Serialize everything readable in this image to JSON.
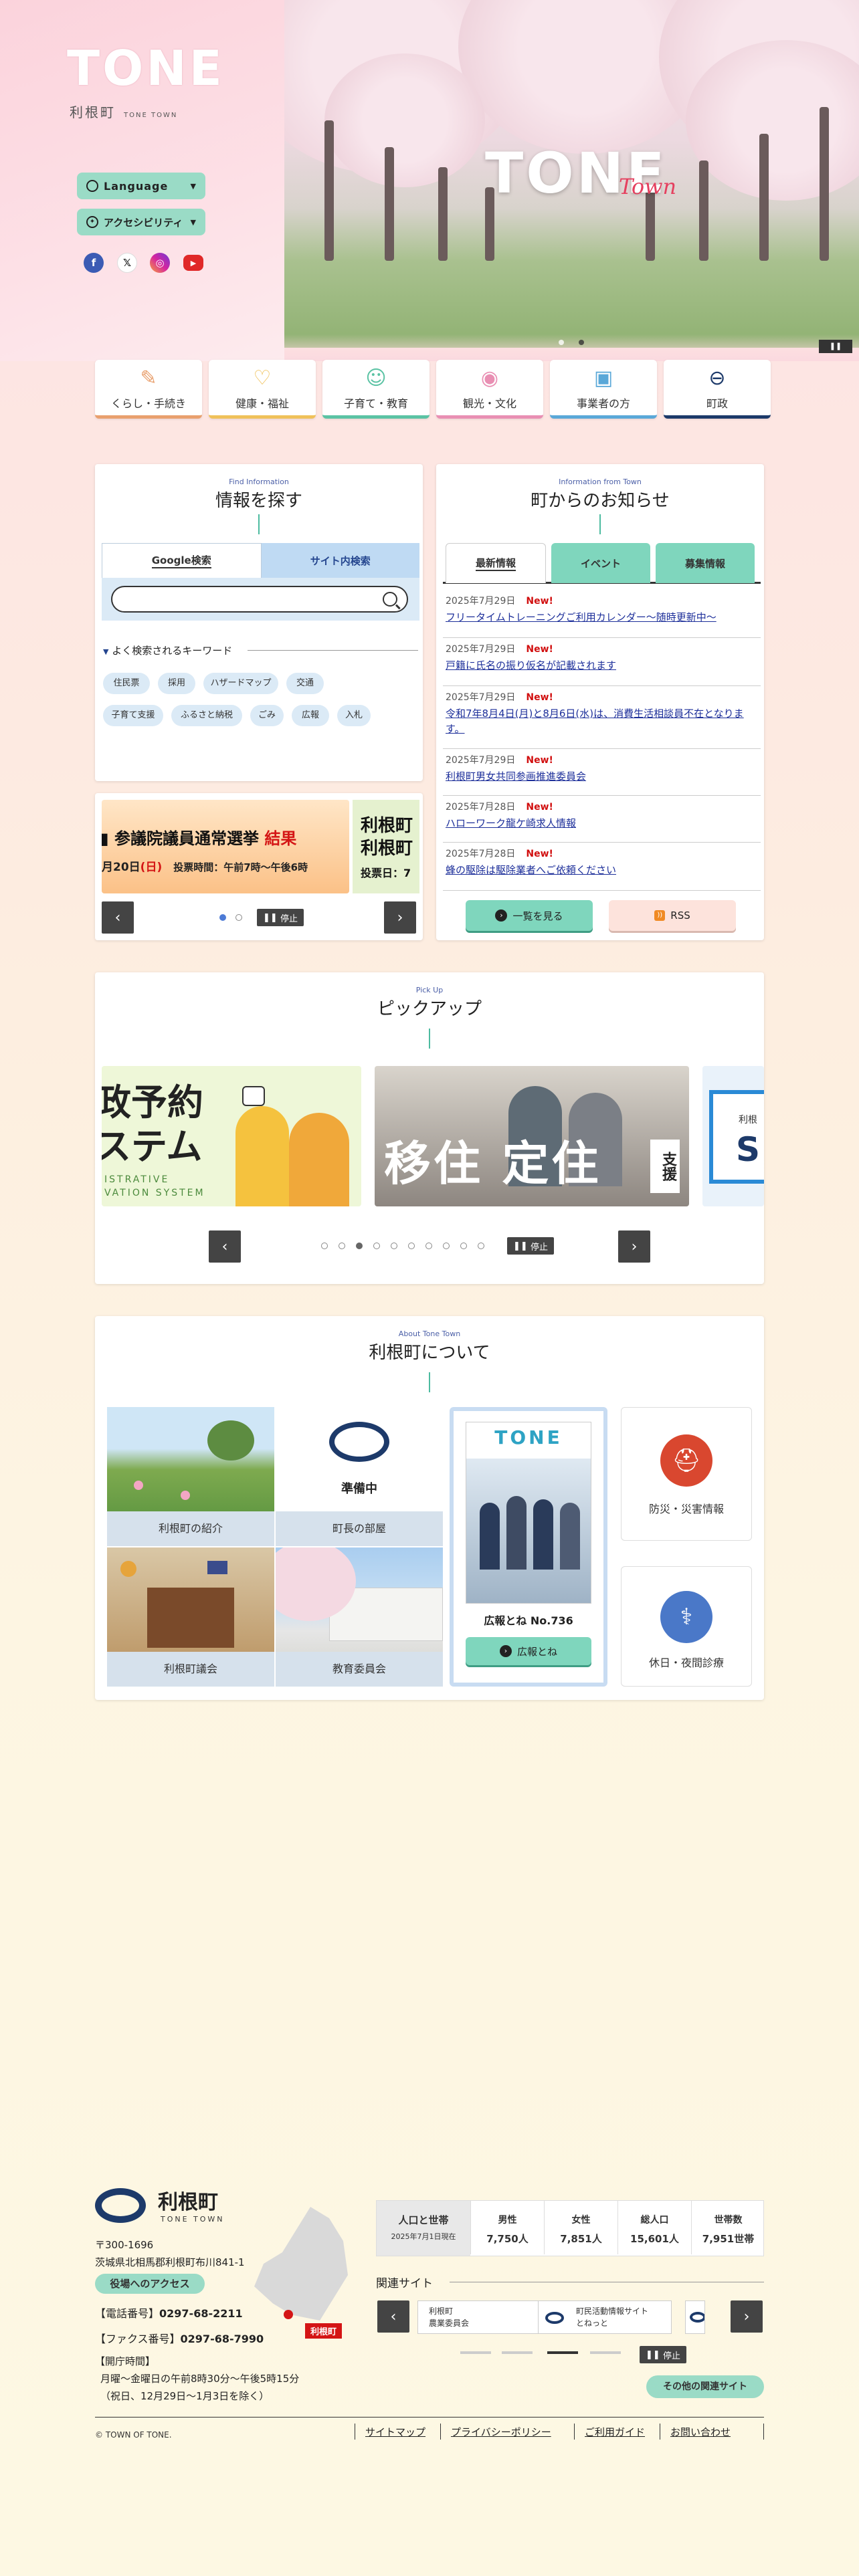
{
  "header": {
    "logo_text": "TONE",
    "logo_sub": "利根町",
    "logo_sub_en": "TONE TOWN",
    "language_label": "Language",
    "accessibility_label": "アクセシビリティ",
    "hero_title": "TONE",
    "hero_script": "Town"
  },
  "categories": [
    {
      "label": "くらし・手続き",
      "color": "#e9a06e",
      "icon": "document-pen-icon"
    },
    {
      "label": "健康・福祉",
      "color": "#f0c15a",
      "icon": "heart-hands-icon"
    },
    {
      "label": "子育て・教育",
      "color": "#5bc3a4",
      "icon": "parent-child-icon"
    },
    {
      "label": "観光・文化",
      "color": "#e98fb3",
      "icon": "camera-icon"
    },
    {
      "label": "事業者の方",
      "color": "#5aa8d8",
      "icon": "briefcase-icon"
    },
    {
      "label": "町政",
      "color": "#1d3a6a",
      "icon": "town-emblem-icon"
    }
  ],
  "search": {
    "eng": "Find Information",
    "title": "情報を探す",
    "tab_google": "Google検索",
    "tab_site": "サイト内検索",
    "placeholder": "",
    "keywords_heading": "よく検索されるキーワード",
    "keywords": [
      "住民票",
      "採用",
      "ハザードマップ",
      "交通",
      "子育て支援",
      "ふるさと納税",
      "ごみ",
      "広報",
      "入札"
    ]
  },
  "banner": {
    "main_title": "参議院議員通常選挙",
    "main_result": "結果",
    "main_date_prefix": "月20日",
    "main_date_day": "(日)",
    "main_time": "投票時間：午前7時～午後6時",
    "side_text1": "利根町",
    "side_text2": "利根町",
    "side_text3": "投票日：7",
    "pause_label": "停止"
  },
  "news": {
    "eng": "Information from Town",
    "title": "町からのお知らせ",
    "tabs": [
      "最新情報",
      "イベント",
      "募集情報"
    ],
    "items": [
      {
        "date": "2025年7月29日",
        "new": "New!",
        "text": "フリータイムトレーニングご利用カレンダー～随時更新中～"
      },
      {
        "date": "2025年7月29日",
        "new": "New!",
        "text": "戸籍に氏名の振り仮名が記載されます"
      },
      {
        "date": "2025年7月29日",
        "new": "New!",
        "text": "令和7年8月4日(月)と8月6日(水)は、消費生活相談員不在となります。"
      },
      {
        "date": "2025年7月29日",
        "new": "New!",
        "text": "利根町男女共同参画推進委員会"
      },
      {
        "date": "2025年7月28日",
        "new": "New!",
        "text": "ハローワーク龍ケ崎求人情報"
      },
      {
        "date": "2025年7月28日",
        "new": "New!",
        "text": "蜂の駆除は駆除業者へご依頼ください"
      }
    ],
    "list_button": "一覧を見る",
    "rss_button": "RSS"
  },
  "pickup": {
    "eng": "Pick Up",
    "title": "ピックアップ",
    "slide1_line1": "政予約",
    "slide1_line2": "ステム",
    "slide1_en1": "ISTRATIVE",
    "slide1_en2": "VATION SYSTEM",
    "slide2_text1": "移住",
    "slide2_text2": "定住",
    "slide2_text3": "支援",
    "slide3_text1": "利根",
    "slide3_text2": "S",
    "pause_label": "停止"
  },
  "about": {
    "eng": "About Tone Town",
    "title": "利根町について",
    "items": [
      "利根町の紹介",
      "町長の部屋",
      "利根町議会",
      "教育委員会"
    ],
    "preparing": "準備中",
    "kouhou_caption": "広報とね No.736",
    "kouhou_button": "広報とね",
    "kouhou_cover_title": "TONE",
    "disaster_label": "防災・災害情報",
    "holiday_label": "休日・夜間診療"
  },
  "footer": {
    "town_name": "利根町",
    "town_en": "TONE TOWN",
    "postal": "〒300-1696",
    "address": "茨城県北相馬郡利根町布川841-1",
    "access_button": "役場へのアクセス",
    "tel_label": "【電話番号】",
    "tel": "0297-68-2211",
    "fax_label": "【ファクス番号】",
    "fax": "0297-68-7990",
    "hours_label": "【開庁時間】",
    "hours1": "月曜～金曜日の午前8時30分～午後5時15分",
    "hours2": "（祝日、12月29日～1月3日を除く）",
    "map_label": "利根町",
    "copyright": "© TOWN OF TONE.",
    "pop_head": "人口と世帯",
    "pop_date": "2025年7月1日現在",
    "pop_cols": [
      {
        "label": "男性",
        "value": "7,750人"
      },
      {
        "label": "女性",
        "value": "7,851人"
      },
      {
        "label": "総人口",
        "value": "15,601人"
      },
      {
        "label": "世帯数",
        "value": "7,951世帯"
      }
    ],
    "related_title": "関連サイト",
    "related_sites": [
      {
        "line1": "利根町",
        "line2": "農業委員会"
      },
      {
        "line1": "町民活動情報サイト",
        "line2": "とねっと"
      }
    ],
    "pause_label": "停止",
    "other_sites": "その他の関連サイト",
    "links": [
      "サイトマップ",
      "プライバシーポリシー",
      "ご利用ガイド",
      "お問い合わせ"
    ]
  },
  "colors": {
    "accent_green": "#7fd6bd",
    "navy": "#1d3a6a",
    "news_link": "#1d2f9a",
    "new_red": "#d10f0f"
  }
}
